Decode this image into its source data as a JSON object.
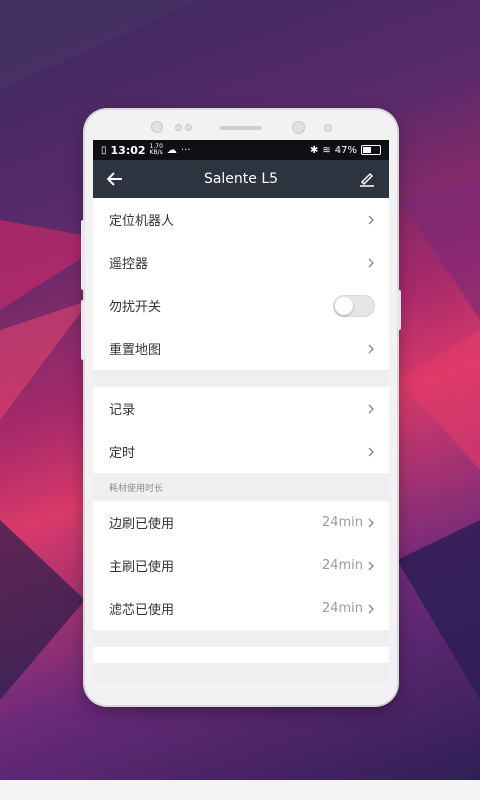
{
  "status_bar": {
    "time": "13:02",
    "speed_value": "1.70",
    "speed_unit": "KB/s",
    "more": "···",
    "battery": "47%",
    "battery_level": 0.47
  },
  "header": {
    "title": "Salente L5",
    "back_icon": "arrow-left-icon",
    "edit_icon": "pencil-icon"
  },
  "groups": {
    "g1": [
      {
        "label": "定位机器人"
      },
      {
        "label": "遥控器"
      },
      {
        "label": "勿扰开关",
        "toggle": false
      },
      {
        "label": "重置地图"
      }
    ],
    "g2": [
      {
        "label": "记录"
      },
      {
        "label": "定时"
      }
    ],
    "consumables_header": "耗材使用时长",
    "g3": [
      {
        "label": "边刷已使用",
        "value": "24min"
      },
      {
        "label": "主刷已使用",
        "value": "24min"
      },
      {
        "label": "滤芯已使用",
        "value": "24min"
      }
    ]
  },
  "colors": {
    "titlebar": "#2e3340",
    "background_accent": "#d83a6a"
  }
}
